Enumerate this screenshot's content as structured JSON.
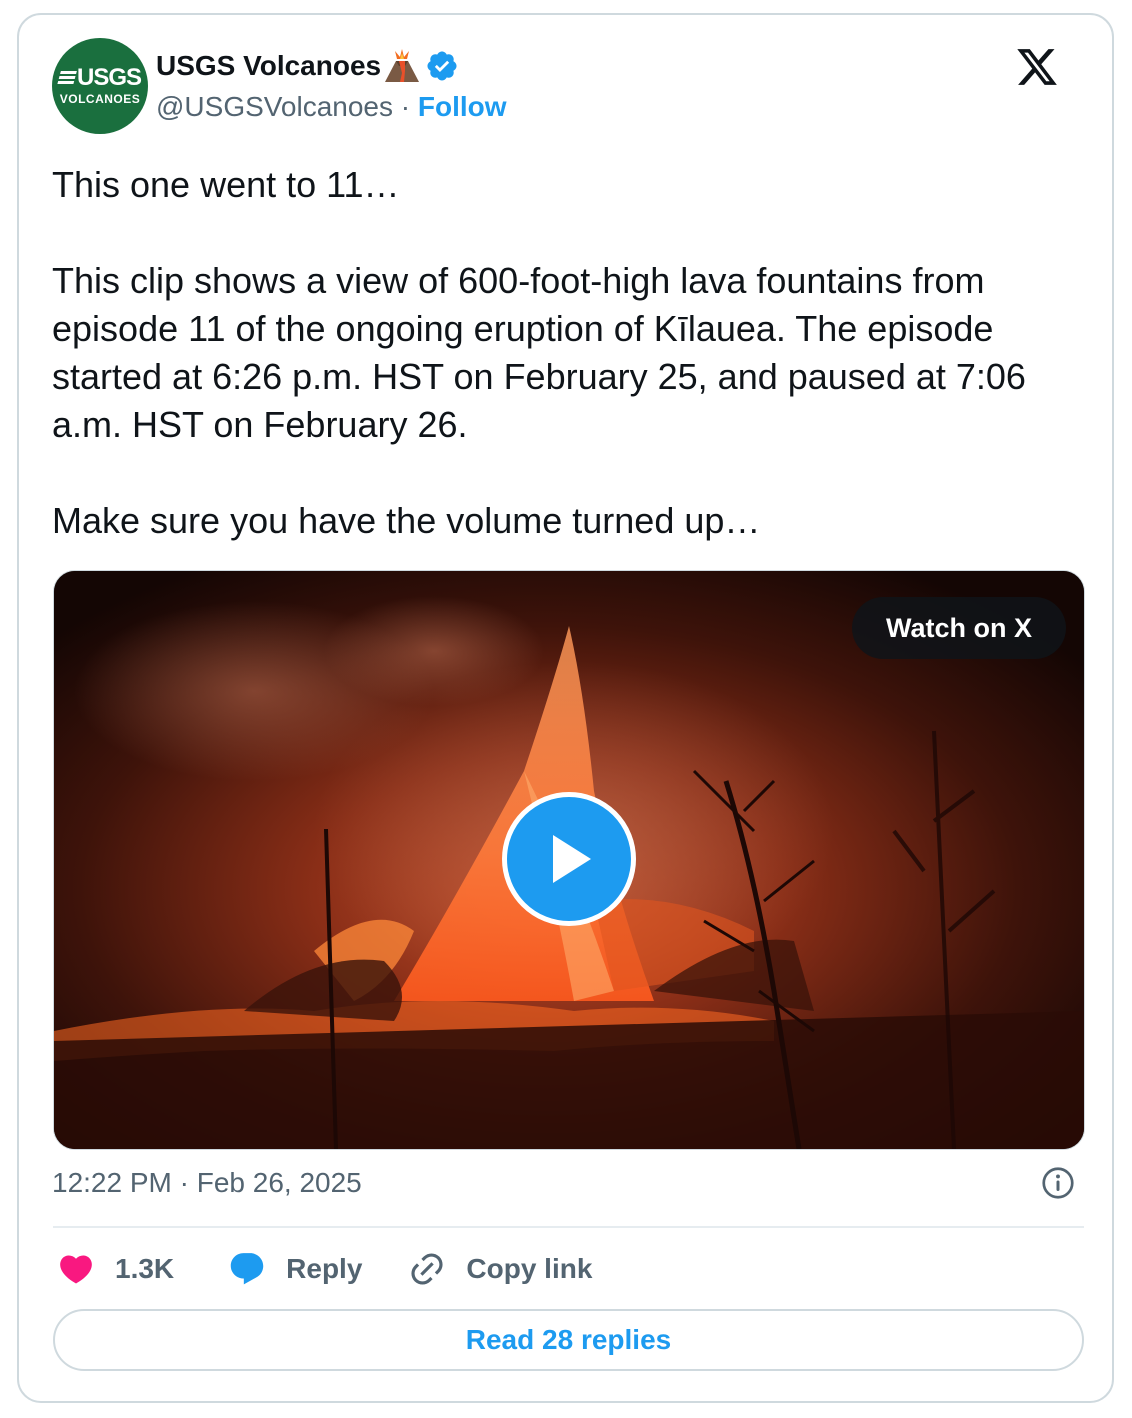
{
  "author": {
    "name": "USGS Volcanoes",
    "handle": "@USGSVolcanoes",
    "separator": "·",
    "follow_label": "Follow",
    "avatar_text_top": "USGS",
    "avatar_text_bottom": "VOLCANOES",
    "avatar_color": "#1a6f3e",
    "verified_color": "#1d9bf0"
  },
  "tweet": {
    "line1": "This one went to 11…",
    "paragraph2": "This clip shows a view of 600-foot-high lava fountains from episode 11 of the ongoing eruption of Kīlauea. The episode started at 6:26 p.m. HST on February 25, and paused at 7:06 a.m. HST on February 26.",
    "line3": "Make sure you have the volume turned up…"
  },
  "media": {
    "watch_label": "Watch on X",
    "play_icon": "play-icon"
  },
  "meta": {
    "timestamp": "12:22 PM · Feb 26, 2025"
  },
  "actions": {
    "like_count": "1.3K",
    "reply_label": "Reply",
    "copy_label": "Copy link",
    "like_color": "#f91880",
    "reply_color": "#1d9bf0"
  },
  "footer": {
    "read_replies_label": "Read 28 replies"
  },
  "accent": "#1d9bf0"
}
